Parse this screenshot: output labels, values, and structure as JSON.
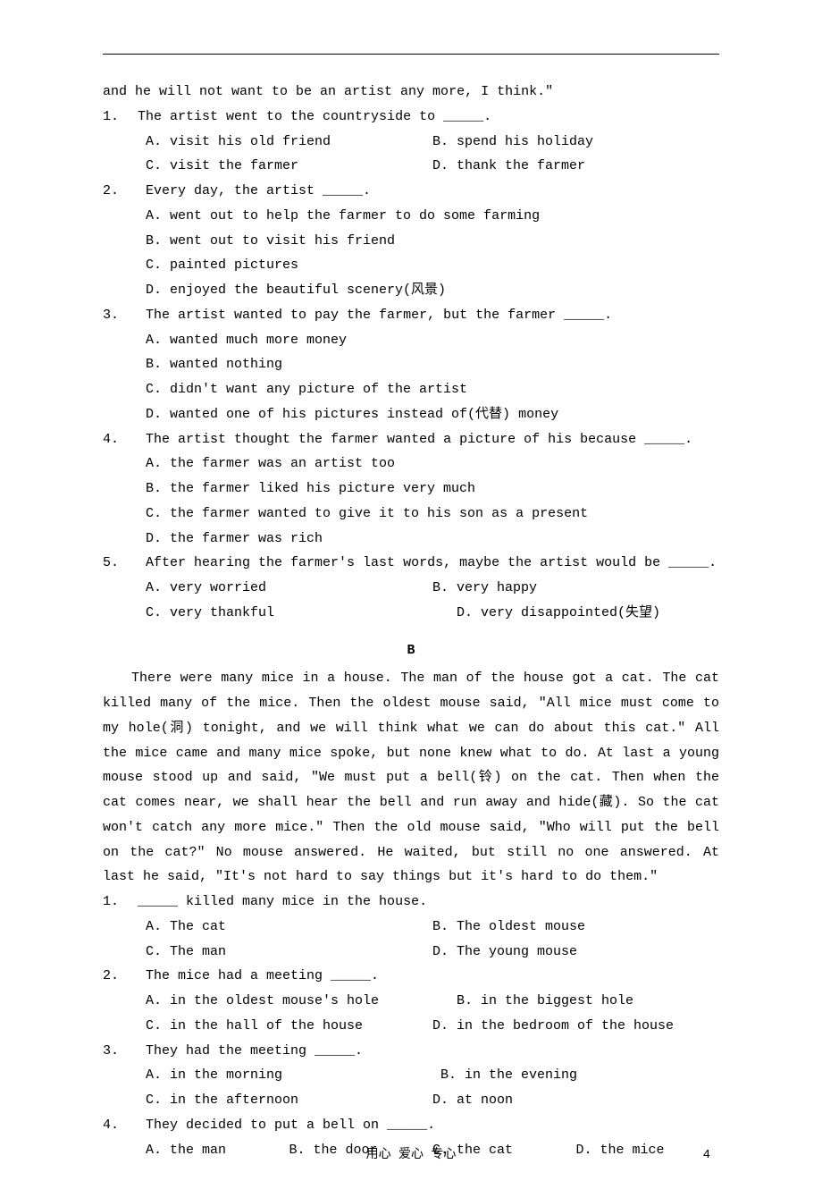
{
  "top_tail": "and he will not want to be an artist any more, I think.\"",
  "qA": [
    {
      "num": "1.",
      "stem": " The artist went to the countryside to _____.",
      "opts": [
        [
          "A. visit his old friend",
          "B. spend his holiday"
        ],
        [
          "C. visit the farmer",
          "D. thank the farmer"
        ]
      ]
    },
    {
      "num": "2.",
      "stem": "  Every day, the artist _____.",
      "singles": [
        "A. went out to help the farmer to do some farming",
        "B. went out to visit his friend",
        "C. painted pictures",
        "D. enjoyed the beautiful scenery(风景)"
      ]
    },
    {
      "num": "3.",
      "stem": "  The artist wanted to pay the farmer, but the farmer _____.",
      "singles": [
        "A. wanted much more money",
        "B. wanted nothing",
        "C. didn't want any picture of the artist",
        "D. wanted one of his pictures instead of(代替) money"
      ]
    },
    {
      "num": "4.",
      "stem": "  The artist thought the farmer wanted a picture of his because _____.",
      "singles": [
        "A. the farmer was an artist too",
        "B. the farmer liked his picture very much",
        "C. the farmer wanted to give it to his son as a present",
        "D. the farmer was rich"
      ]
    },
    {
      "num": "5.",
      "stem": "  After hearing the farmer's last words, maybe the artist would be _____.",
      "opts": [
        [
          "A. very worried",
          "B. very happy"
        ],
        [
          "C. very thankful",
          "   D. very disappointed(失望)"
        ]
      ]
    }
  ],
  "section_b": "B",
  "passage_b": "There were many mice in a house. The man of the house got a cat. The cat killed many of the mice. Then the oldest mouse said, \"All mice must come to my hole(洞) tonight, and we will think what we can do about this cat.\" All the mice came and many mice spoke, but none knew what to do. At last a young mouse stood up and said, \"We must put a bell(铃) on the cat. Then when the cat comes near, we shall hear the bell and run away and hide(藏). So the cat won't catch any more mice.\" Then the old mouse said, \"Who will put the bell on the cat?\" No mouse answered. He waited, but still no one answered. At last he said, \"It's not hard to say things but it's hard to do them.\"",
  "qB": [
    {
      "num": "1.",
      "stem": " _____ killed many mice in the house.",
      "opts": [
        [
          "A. The cat",
          "B. The oldest mouse"
        ],
        [
          "C. The man",
          "D. The young mouse"
        ]
      ]
    },
    {
      "num": "2.",
      "stem": "  The mice had a meeting _____.",
      "opts": [
        [
          "A. in the oldest mouse's hole",
          "   B. in the biggest hole"
        ],
        [
          "C. in the hall of the house",
          "D. in the bedroom of the house"
        ]
      ]
    },
    {
      "num": "3.",
      "stem": "  They had the meeting _____.",
      "opts": [
        [
          "A. in the morning",
          " B. in the evening"
        ],
        [
          "C. in the afternoon",
          "D. at noon"
        ]
      ]
    },
    {
      "num": "4.",
      "stem": "  They decided to put a bell on _____.",
      "four": [
        "A. the man",
        "B. the door",
        "C. the cat",
        "D. the mice"
      ]
    }
  ],
  "footer": {
    "text": "用心     爱心     专心",
    "page": "4"
  }
}
